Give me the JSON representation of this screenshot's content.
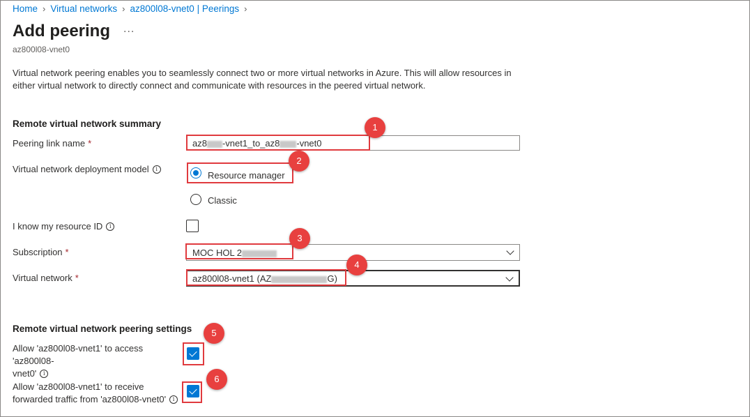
{
  "breadcrumb": {
    "home": "Home",
    "virtual_networks": "Virtual networks",
    "peerings": "az800l08-vnet0 | Peerings"
  },
  "page": {
    "title": "Add peering",
    "more": "...",
    "subtitle": "az800l08-vnet0",
    "description": "Virtual network peering enables you to seamlessly connect two or more virtual networks in Azure. This will allow resources in either virtual network to directly connect and communicate with resources in the peered virtual network."
  },
  "remote_summary": {
    "heading": "Remote virtual network summary",
    "peering_link": {
      "label": "Peering link name",
      "required": "*",
      "value_a": "az8",
      "value_b": "-vnet1_to_az8",
      "value_c": "-vnet0"
    },
    "deployment_model": {
      "label": "Virtual network deployment model",
      "options": [
        "Resource manager",
        "Classic"
      ],
      "selected": "Resource manager"
    },
    "know_resource_id": {
      "label": "I know my resource ID",
      "checked": false
    },
    "subscription": {
      "label": "Subscription",
      "required": "*",
      "value": "MOC HOL 2"
    },
    "virtual_network": {
      "label": "Virtual network",
      "required": "*",
      "value_a": "az800l08-vnet1 (AZ",
      "value_b": "G)"
    }
  },
  "remote_settings": {
    "heading": "Remote virtual network peering settings",
    "allow_access": {
      "line1": "Allow 'az800l08-vnet1' to access 'az800l08-",
      "line2": "vnet0'",
      "checked": true
    },
    "allow_forwarded": {
      "line1": "Allow 'az800l08-vnet1' to receive",
      "line2": "forwarded traffic from 'az800l08-vnet0'",
      "checked": true
    }
  },
  "badges": [
    "1",
    "2",
    "3",
    "4",
    "5",
    "6"
  ],
  "icons": {
    "info": "info-icon",
    "chevron": "chevron-down-icon",
    "checkmark": "checkmark-icon"
  },
  "colors": {
    "accent": "#0078d4",
    "highlight": "#e03a3e",
    "badge": "#e8403f"
  }
}
